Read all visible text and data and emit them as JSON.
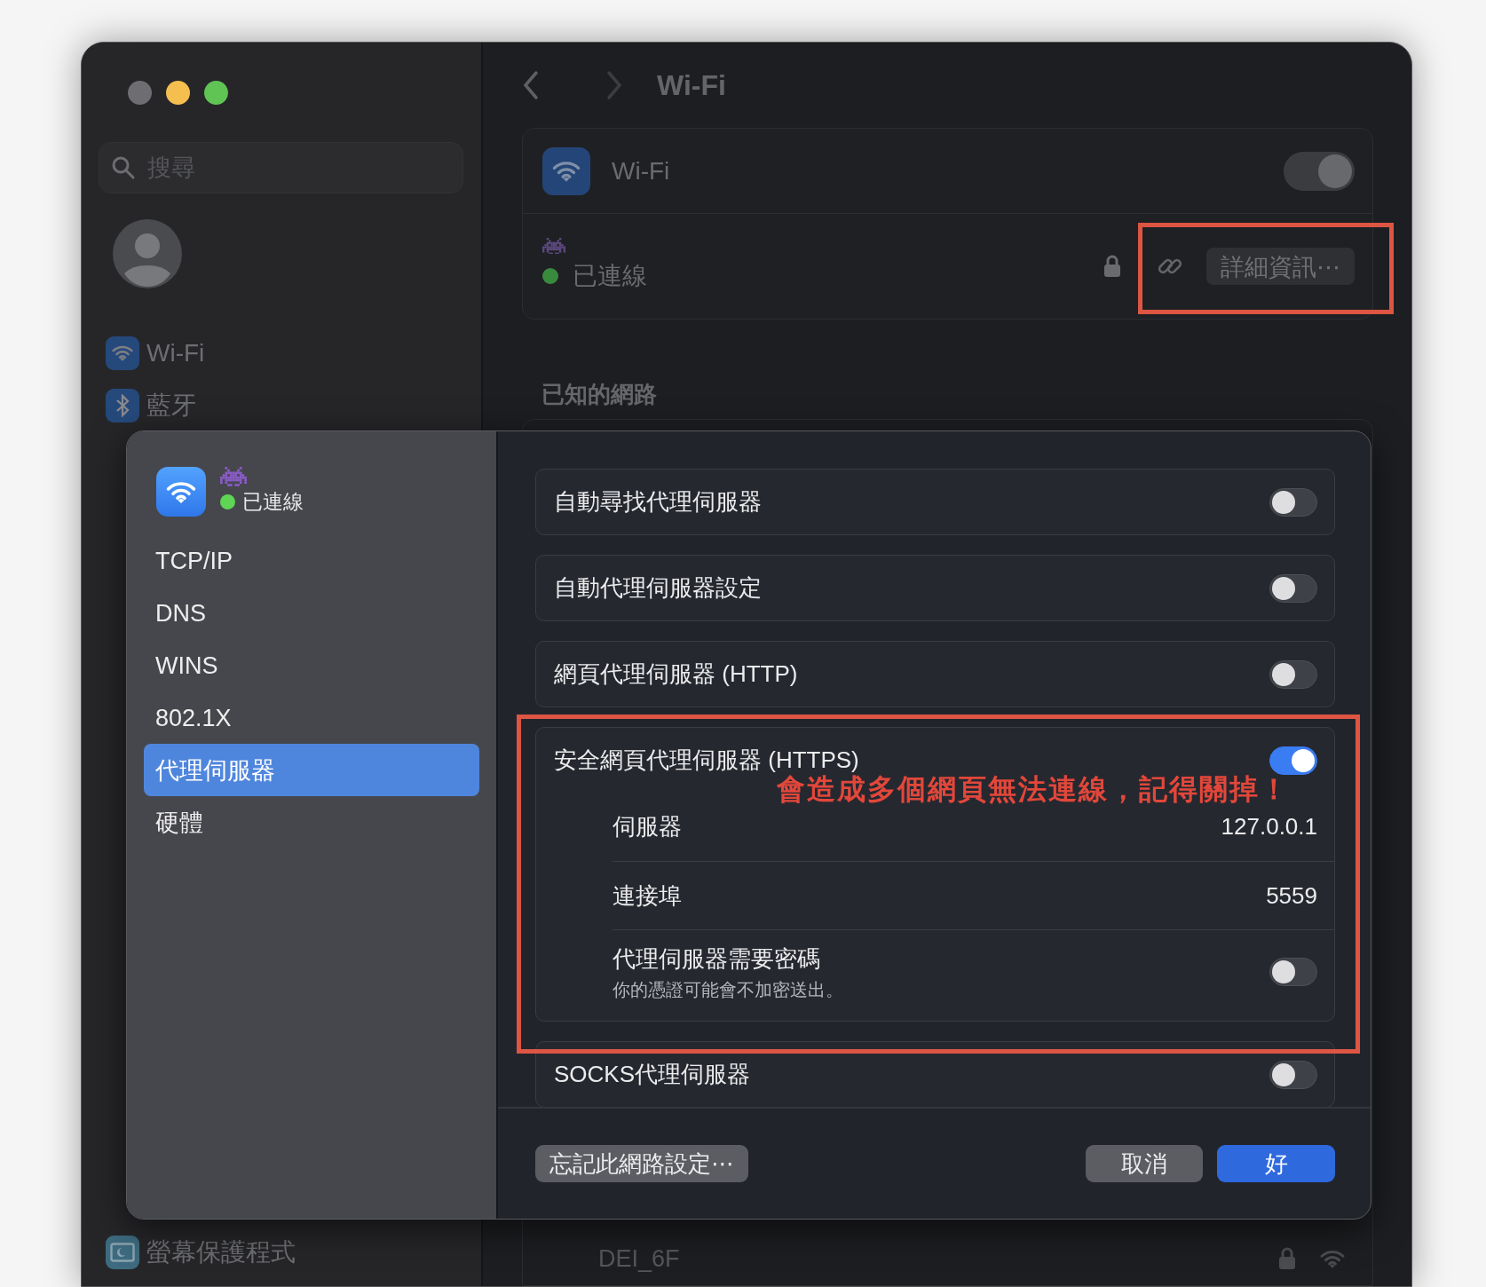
{
  "window": {
    "controls": [
      {
        "color": "#6e6e72"
      },
      {
        "color": "#f4bf4f"
      },
      {
        "color": "#5fc454"
      }
    ]
  },
  "sidebar": {
    "search": {
      "placeholder": "搜尋"
    },
    "items": [
      {
        "label": "Wi-Fi",
        "kind": "wifi"
      },
      {
        "label": "藍牙",
        "kind": "bluetooth"
      },
      {
        "label": "螢幕保護程式",
        "kind": "screensaver"
      }
    ]
  },
  "main": {
    "title": "Wi-Fi",
    "wifi_card": {
      "label": "Wi-Fi",
      "on": true,
      "status": "已連線",
      "details_button": "詳細資訊⋯"
    },
    "known_networks": {
      "heading": "已知的網路",
      "rows": [
        {
          "name": "DEI_6F"
        }
      ]
    }
  },
  "sheet": {
    "status": "已連線",
    "tabs": [
      {
        "label": "TCP/IP",
        "selected": false
      },
      {
        "label": "DNS",
        "selected": false
      },
      {
        "label": "WINS",
        "selected": false
      },
      {
        "label": "802.1X",
        "selected": false
      },
      {
        "label": "代理伺服器",
        "selected": true
      },
      {
        "label": "硬體",
        "selected": false
      }
    ],
    "proxies": [
      {
        "label": "自動尋找代理伺服器",
        "on": false
      },
      {
        "label": "自動代理伺服器設定",
        "on": false
      },
      {
        "label": "網頁代理伺服器 (HTTP)",
        "on": false
      },
      {
        "label": "安全網頁代理伺服器 (HTTPS)",
        "on": true,
        "fields": [
          {
            "label": "伺服器",
            "value": "127.0.0.1"
          },
          {
            "label": "連接埠",
            "value": "5559"
          }
        ],
        "password": {
          "label": "代理伺服器需要密碼",
          "note": "你的憑證可能會不加密送出。",
          "on": false
        }
      },
      {
        "label": "SOCKS代理伺服器",
        "on": false
      }
    ],
    "buttons": {
      "forget": "忘記此網路設定⋯",
      "cancel": "取消",
      "ok": "好"
    }
  },
  "annotation": {
    "text": "會造成多個網頁無法連線，記得關掉！"
  }
}
